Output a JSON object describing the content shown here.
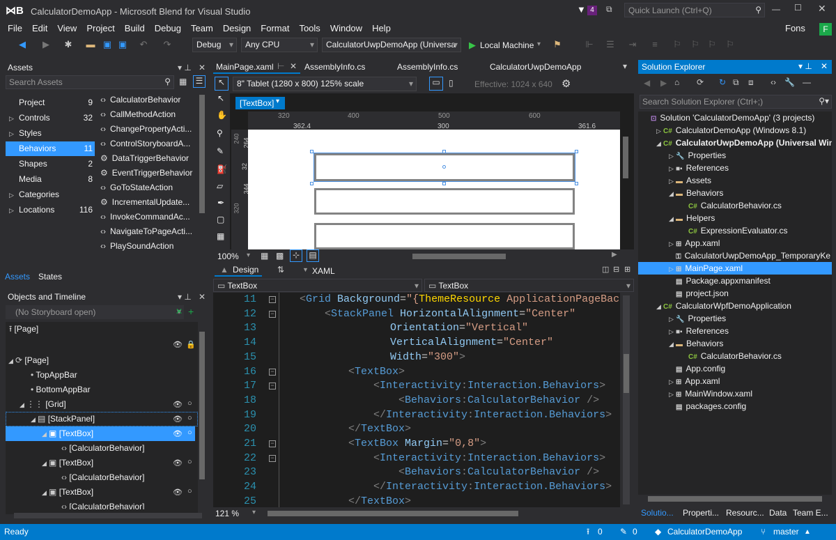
{
  "window": {
    "title": "CalculatorDemoApp - Microsoft Blend for Visual Studio",
    "notifications": "4",
    "quick_launch": "Quick Launch (Ctrl+Q)",
    "user": "Fons",
    "user_initial": "F"
  },
  "menu": [
    "File",
    "Edit",
    "View",
    "Project",
    "Build",
    "Debug",
    "Team",
    "Design",
    "Format",
    "Tools",
    "Window",
    "Help"
  ],
  "toolbar": {
    "config": "Debug",
    "platform": "Any CPU",
    "startup": "CalculatorUwpDemoApp (Universa",
    "run": "Local Machine"
  },
  "assets": {
    "title": "Assets",
    "search_placeholder": "Search Assets",
    "categories": [
      {
        "label": "Project",
        "count": "9"
      },
      {
        "label": "Controls",
        "count": "32"
      },
      {
        "label": "Styles",
        "count": ""
      },
      {
        "label": "Behaviors",
        "count": "11"
      },
      {
        "label": "Shapes",
        "count": "2"
      },
      {
        "label": "Media",
        "count": "8"
      },
      {
        "label": "Categories",
        "count": ""
      },
      {
        "label": "Locations",
        "count": "116"
      }
    ],
    "items": [
      "CalculatorBehavior",
      "CallMethodAction",
      "ChangePropertyActi...",
      "ControlStoryboardA...",
      "DataTriggerBehavior",
      "EventTriggerBehavior",
      "GoToStateAction",
      "IncrementalUpdate...",
      "InvokeCommandAc...",
      "NavigateToPageActi...",
      "PlaySoundAction"
    ],
    "tabs": [
      "Assets",
      "States"
    ]
  },
  "objects": {
    "title": "Objects and Timeline",
    "storyboard": "(No Storyboard open)",
    "nodes": [
      "[Page]",
      "[Page]",
      "TopAppBar",
      "BottomAppBar",
      "[Grid]",
      "[StackPanel]",
      "[TextBox]",
      "[CalculatorBehavior]",
      "[TextBox]",
      "[CalculatorBehavior]",
      "[TextBox]",
      "[CalculatorBehavior]"
    ]
  },
  "doc_tabs": [
    "MainPage.xaml",
    "AssemblyInfo.cs",
    "AssemblyInfo.cs",
    "CalculatorUwpDemoApp"
  ],
  "designer": {
    "device": "8\" Tablet (1280 x 800) 125% scale",
    "effective": "Effective: 1024 x 640",
    "selection_tag": "[TextBox]",
    "ruler_top": [
      "320",
      "400",
      "500",
      "600"
    ],
    "ruler_measure": [
      "362.4",
      "300",
      "361.6"
    ],
    "ruler_left": [
      "240",
      "264",
      "32",
      "344",
      "320"
    ],
    "zoom": "100%"
  },
  "split": {
    "design": "Design",
    "xaml": "XAML",
    "crumb_left": "TextBox",
    "crumb_right": "TextBox",
    "zoom": "121 %"
  },
  "code_lines": [
    {
      "n": "11",
      "c": [
        [
          "p",
          "<"
        ],
        [
          "t",
          "Grid "
        ],
        [
          "a",
          "Background"
        ],
        [
          "v",
          "="
        ],
        [
          "s",
          "\"{"
        ],
        [
          "y",
          "ThemeResource "
        ],
        [
          "s",
          "ApplicationPageBackgr"
        ]
      ]
    },
    {
      "n": "12",
      "c": [
        [
          "p",
          "<"
        ],
        [
          "t",
          "StackPanel "
        ],
        [
          "a",
          "HorizontalAlignment"
        ],
        [
          "v",
          "="
        ],
        [
          "s",
          "\"Center\""
        ]
      ]
    },
    {
      "n": "13",
      "c": [
        [
          "a",
          "Orientation"
        ],
        [
          "v",
          "="
        ],
        [
          "s",
          "\"Vertical\""
        ]
      ]
    },
    {
      "n": "14",
      "c": [
        [
          "a",
          "VerticalAlignment"
        ],
        [
          "v",
          "="
        ],
        [
          "s",
          "\"Center\""
        ]
      ]
    },
    {
      "n": "15",
      "c": [
        [
          "a",
          "Width"
        ],
        [
          "v",
          "="
        ],
        [
          "s",
          "\"300\""
        ],
        [
          "p",
          ">"
        ]
      ]
    },
    {
      "n": "16",
      "c": [
        [
          "p",
          "<"
        ],
        [
          "t",
          "TextBox"
        ],
        [
          "p",
          ">"
        ]
      ]
    },
    {
      "n": "17",
      "c": [
        [
          "p",
          "<"
        ],
        [
          "t",
          "Interactivity"
        ],
        [
          "p",
          ":"
        ],
        [
          "t",
          "Interaction.Behaviors"
        ],
        [
          "p",
          ">"
        ]
      ]
    },
    {
      "n": "18",
      "c": [
        [
          "p",
          "<"
        ],
        [
          "t",
          "Behaviors"
        ],
        [
          "p",
          ":"
        ],
        [
          "t",
          "CalculatorBehavior "
        ],
        [
          "p",
          "/>"
        ]
      ]
    },
    {
      "n": "19",
      "c": [
        [
          "p",
          "</"
        ],
        [
          "t",
          "Interactivity"
        ],
        [
          "p",
          ":"
        ],
        [
          "t",
          "Interaction.Behaviors"
        ],
        [
          "p",
          ">"
        ]
      ]
    },
    {
      "n": "20",
      "c": [
        [
          "p",
          "</"
        ],
        [
          "t",
          "TextBox"
        ],
        [
          "p",
          ">"
        ]
      ]
    },
    {
      "n": "21",
      "c": [
        [
          "p",
          "<"
        ],
        [
          "t",
          "TextBox "
        ],
        [
          "a",
          "Margin"
        ],
        [
          "v",
          "="
        ],
        [
          "s",
          "\"0,8\""
        ],
        [
          "p",
          ">"
        ]
      ]
    },
    {
      "n": "22",
      "c": [
        [
          "p",
          "<"
        ],
        [
          "t",
          "Interactivity"
        ],
        [
          "p",
          ":"
        ],
        [
          "t",
          "Interaction.Behaviors"
        ],
        [
          "p",
          ">"
        ]
      ]
    },
    {
      "n": "23",
      "c": [
        [
          "p",
          "<"
        ],
        [
          "t",
          "Behaviors"
        ],
        [
          "p",
          ":"
        ],
        [
          "t",
          "CalculatorBehavior "
        ],
        [
          "p",
          "/>"
        ]
      ]
    },
    {
      "n": "24",
      "c": [
        [
          "p",
          "</"
        ],
        [
          "t",
          "Interactivity"
        ],
        [
          "p",
          ":"
        ],
        [
          "t",
          "Interaction.Behaviors"
        ],
        [
          "p",
          ">"
        ]
      ]
    },
    {
      "n": "25",
      "c": [
        [
          "p",
          "</"
        ],
        [
          "t",
          "TextBox"
        ],
        [
          "p",
          ">"
        ]
      ]
    }
  ],
  "solution": {
    "title": "Solution Explorer",
    "search_placeholder": "Search Solution Explorer (Ctrl+;)",
    "items": [
      "Solution 'CalculatorDemoApp' (3 projects)",
      "CalculatorDemoApp (Windows 8.1)",
      "CalculatorUwpDemoApp (Universal Wind",
      "Properties",
      "References",
      "Assets",
      "Behaviors",
      "CalculatorBehavior.cs",
      "Helpers",
      "ExpressionEvaluator.cs",
      "App.xaml",
      "CalculatorUwpDemoApp_TemporaryKe",
      "MainPage.xaml",
      "Package.appxmanifest",
      "project.json",
      "CalculatorWpfDemoApplication",
      "Properties",
      "References",
      "Behaviors",
      "CalculatorBehavior.cs",
      "App.config",
      "App.xaml",
      "MainWindow.xaml",
      "packages.config"
    ],
    "tabs": [
      "Solutio...",
      "Properti...",
      "Resourc...",
      "Data",
      "Team E..."
    ]
  },
  "status": {
    "left": "Ready",
    "up": "0",
    "edits": "0",
    "repo": "CalculatorDemoApp",
    "branch": "master"
  }
}
